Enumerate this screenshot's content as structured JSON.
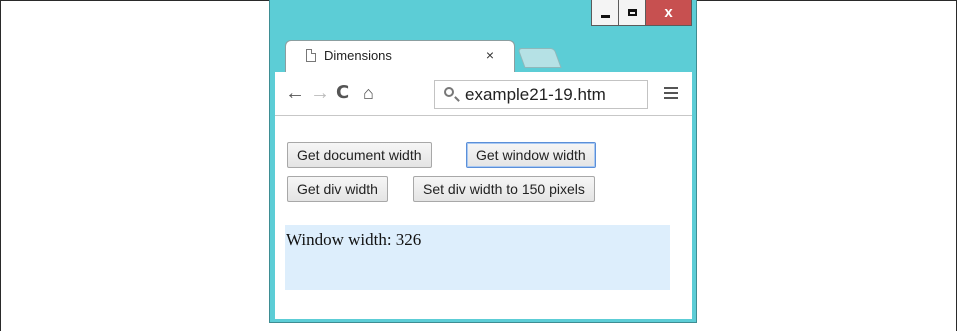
{
  "window": {
    "controls": {
      "minimize": "minimize",
      "maximize": "maximize",
      "close": "x"
    }
  },
  "tab": {
    "title": "Dimensions",
    "close": "×"
  },
  "toolbar": {
    "back": "←",
    "forward": "→",
    "reload": "C",
    "home": "⌂",
    "url": "example21-19.htm"
  },
  "page": {
    "buttons": {
      "doc_width": "Get document width",
      "window_width": "Get window width",
      "div_width": "Get div width",
      "set_div_width": "Set div width to 150 pixels"
    },
    "output": "Window width: 326"
  },
  "colors": {
    "window_chrome": "#5ccdd6",
    "close_button": "#c75050",
    "output_bg": "#ddeefc"
  }
}
